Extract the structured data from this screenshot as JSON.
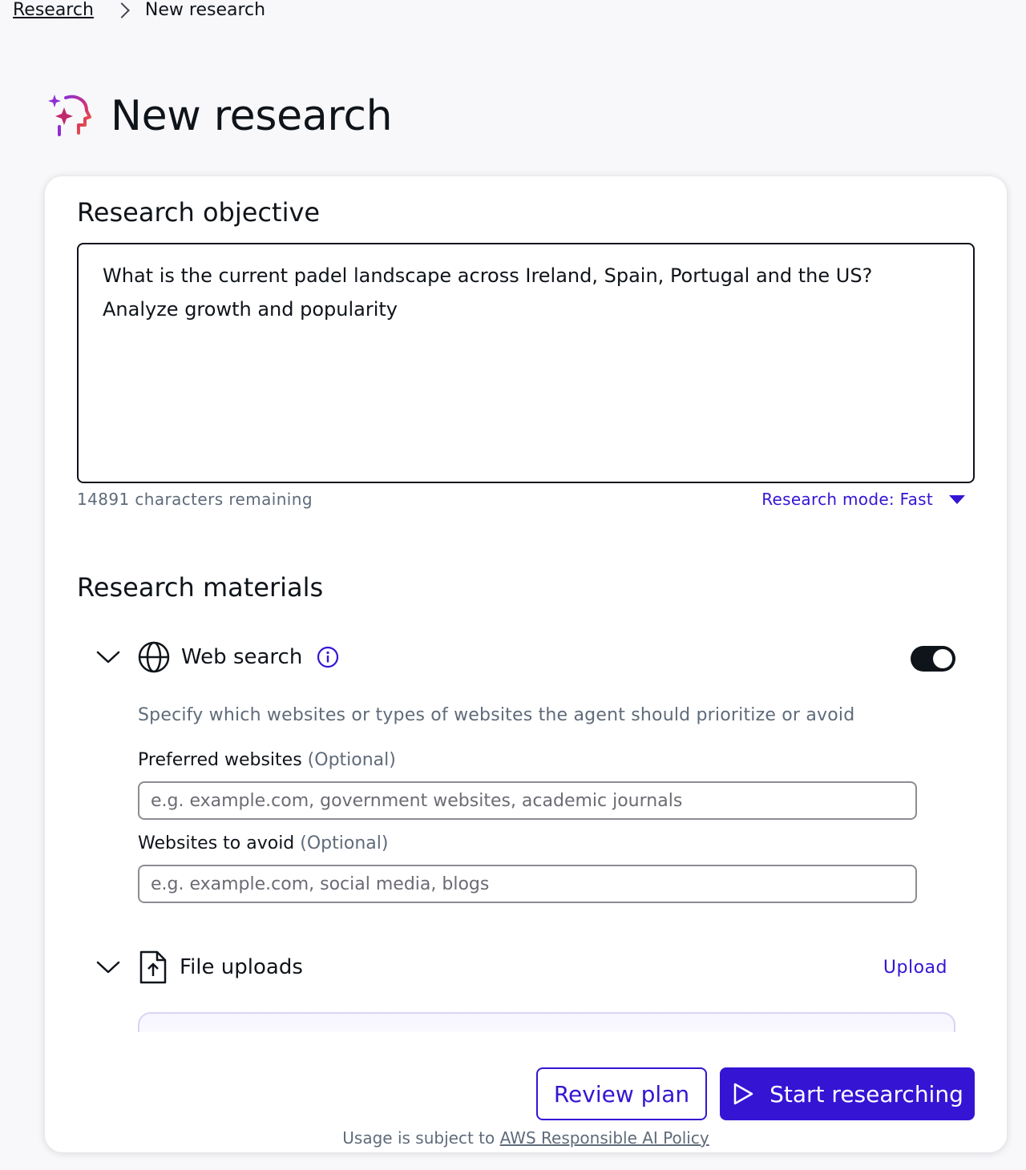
{
  "breadcrumb": {
    "parent": "Research",
    "current": "New research"
  },
  "page": {
    "title": "New research"
  },
  "objective": {
    "heading": "Research objective",
    "text": "What is the current padel landscape across Ireland, Spain, Portugal and the US? Analyze growth and popularity",
    "remaining": "14891 characters remaining",
    "mode_label": "Research mode: Fast"
  },
  "materials": {
    "heading": "Research materials",
    "web_search": {
      "label": "Web search",
      "enabled": true,
      "hint": "Specify which websites or types of websites the agent should prioritize or avoid",
      "preferred_label": "Preferred websites",
      "preferred_optional": "(Optional)",
      "preferred_placeholder": "e.g. example.com, government websites, academic journals",
      "avoid_label": "Websites to avoid",
      "avoid_optional": "(Optional)",
      "avoid_placeholder": "e.g. example.com, social media, blogs"
    },
    "file_uploads": {
      "label": "File uploads",
      "upload_link": "Upload"
    }
  },
  "actions": {
    "review": "Review plan",
    "start": "Start researching"
  },
  "footer": {
    "usage_text": "Usage is subject to ",
    "policy_link": "AWS Responsible AI Policy"
  },
  "colors": {
    "accent": "#3514d4",
    "text": "#0f141a",
    "muted": "#5f6b7a"
  },
  "icons": [
    "chevron-right-icon",
    "research-sparkle-icon",
    "chevron-down-icon",
    "globe-icon",
    "info-icon",
    "file-upload-icon",
    "play-icon"
  ]
}
